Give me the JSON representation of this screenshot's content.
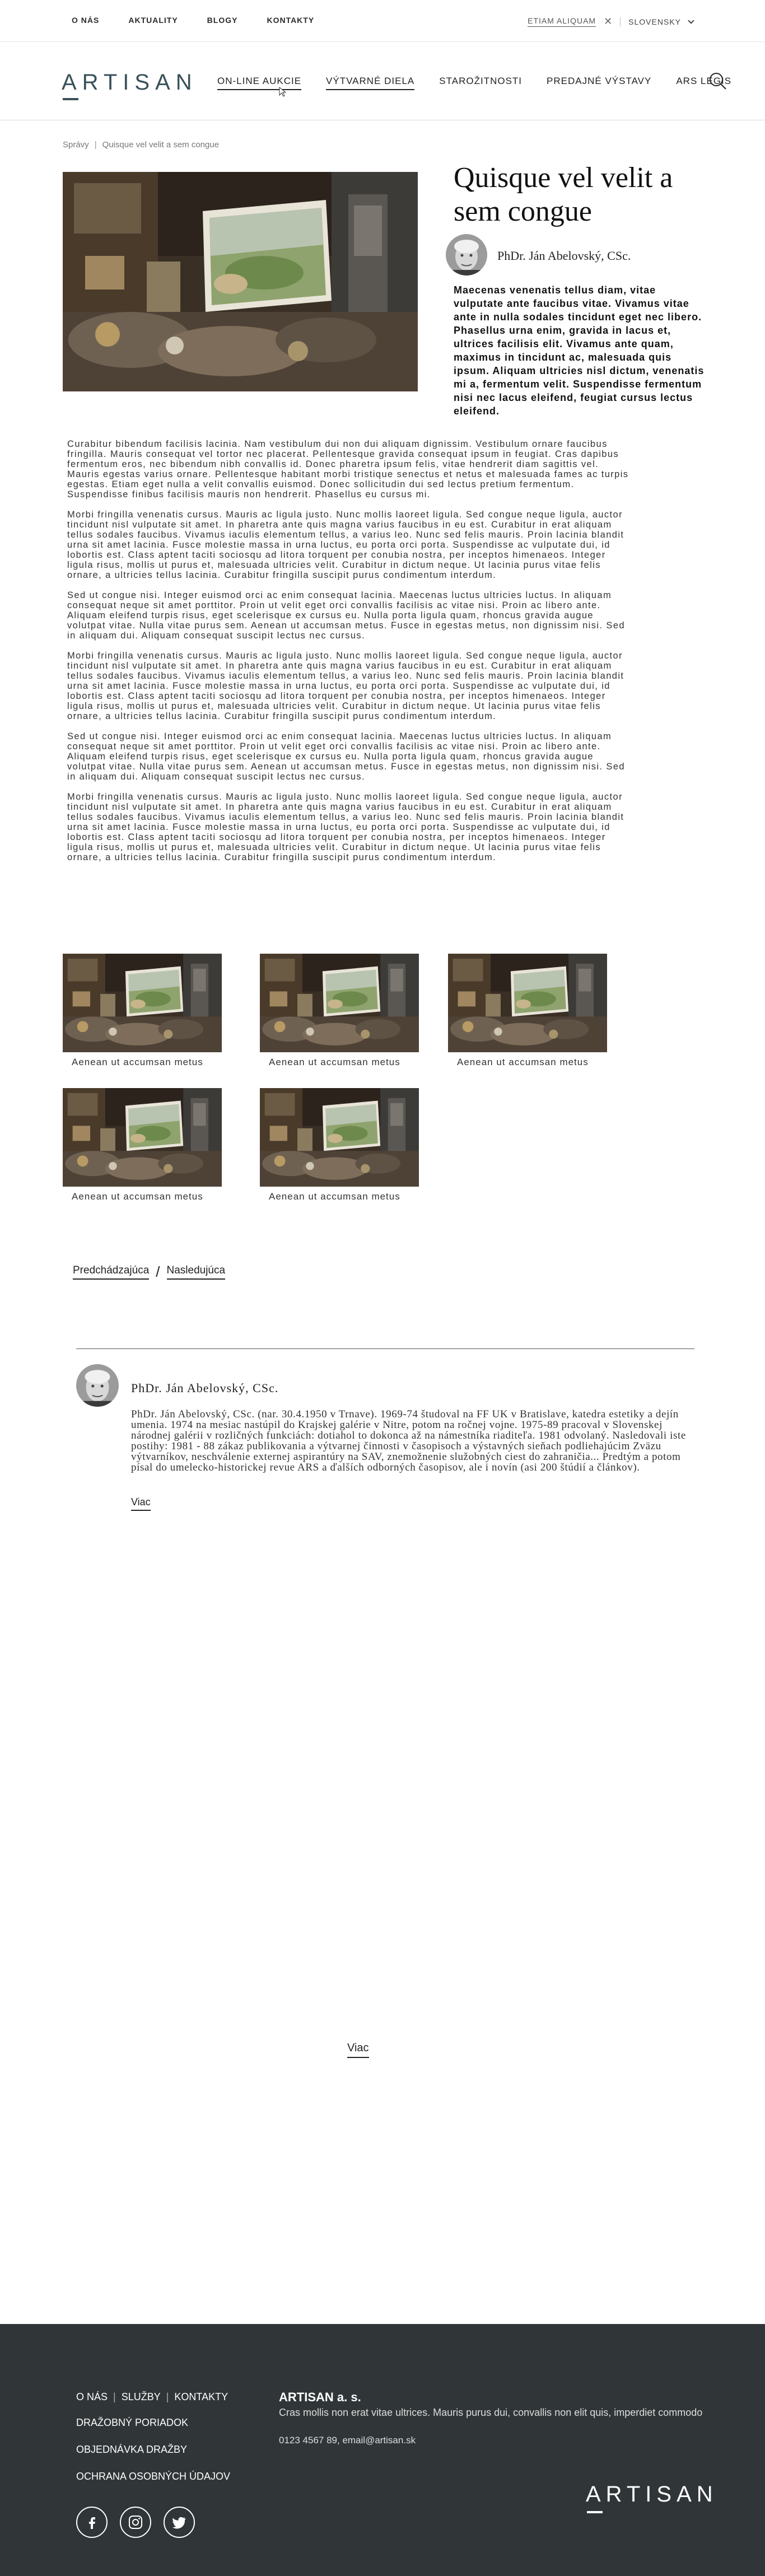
{
  "topbar": {
    "links": [
      "O NÁS",
      "AKTUALITY",
      "BLOGY",
      "KONTAKTY"
    ],
    "search_tag": "ETIAM ALIQUAM",
    "language": "SLOVENSKY"
  },
  "header": {
    "logo": "ARTISAN",
    "nav": [
      "ON-LINE AUKCIE",
      "VÝTVARNÉ DIELA",
      "STAROŽITNOSTI",
      "PREDAJNÉ VÝSTAVY",
      "ARS LEGIS"
    ]
  },
  "breadcrumb": {
    "root": "Správy",
    "current": "Quisque vel velit a sem congue"
  },
  "article": {
    "title": "Quisque vel velit a sem congue",
    "author": "PhDr. Ján Abelovský, CSc.",
    "lead": "Maecenas venenatis tellus diam, vitae vulputate ante faucibus vitae. Vivamus vitae ante in nulla sodales tincidunt eget nec libero. Phasellus urna enim, gravida in lacus et, ultrices facilisis elit. Vivamus ante quam, maximus in tincidunt ac, malesuada quis ipsum. Aliquam ultricies nisl dictum, venenatis mi a, fermentum velit. Suspendisse fermentum nisi nec lacus eleifend, feugiat cursus lectus eleifend.",
    "paragraphs": [
      "Curabitur bibendum facilisis lacinia. Nam vestibulum dui non dui aliquam dignissim. Vestibulum ornare faucibus fringilla. Mauris consequat vel tortor nec placerat. Pellentesque gravida consequat ipsum in feugiat. Cras dapibus fermentum eros, nec bibendum nibh convallis id. Donec pharetra ipsum felis, vitae hendrerit diam sagittis vel. Mauris egestas varius ornare. Pellentesque habitant morbi tristique senectus et netus et malesuada fames ac turpis egestas. Etiam eget nulla a velit convallis euismod. Donec sollicitudin dui sed lectus pretium fermentum. Suspendisse finibus facilisis mauris non hendrerit. Phasellus eu cursus mi.",
      "Morbi fringilla venenatis cursus. Mauris ac ligula justo. Nunc mollis laoreet ligula. Sed congue neque ligula, auctor tincidunt nisl vulputate sit amet. In pharetra ante quis magna varius faucibus in eu est. Curabitur in erat aliquam tellus sodales faucibus. Vivamus iaculis elementum tellus, a varius leo. Nunc sed felis mauris. Proin lacinia blandit urna sit amet lacinia. Fusce molestie massa in urna luctus, eu porta orci porta. Suspendisse ac vulputate dui, id lobortis est. Class aptent taciti sociosqu ad litora torquent per conubia nostra, per inceptos himenaeos. Integer ligula risus, mollis ut purus et, malesuada ultricies velit. Curabitur in dictum neque. Ut lacinia purus vitae felis ornare, a ultricies tellus lacinia. Curabitur fringilla suscipit purus condimentum interdum.",
      "Sed ut congue nisi. Integer euismod orci ac enim consequat lacinia. Maecenas luctus ultricies luctus. In aliquam consequat neque sit amet porttitor. Proin ut velit eget orci convallis facilisis ac vitae nisi. Proin ac libero ante. Aliquam eleifend turpis risus, eget scelerisque ex cursus eu. Nulla porta ligula quam, rhoncus gravida augue volutpat vitae. Nulla vitae purus sem. Aenean ut accumsan metus. Fusce in egestas metus, non dignissim nisi. Sed in aliquam dui. Aliquam consequat suscipit lectus nec cursus.",
      "Morbi fringilla venenatis cursus. Mauris ac ligula justo. Nunc mollis laoreet ligula. Sed congue neque ligula, auctor tincidunt nisl vulputate sit amet. In pharetra ante quis magna varius faucibus in eu est. Curabitur in erat aliquam tellus sodales faucibus. Vivamus iaculis elementum tellus, a varius leo. Nunc sed felis mauris. Proin lacinia blandit urna sit amet lacinia. Fusce molestie massa in urna luctus, eu porta orci porta. Suspendisse ac vulputate dui, id lobortis est. Class aptent taciti sociosqu ad litora torquent per conubia nostra, per inceptos himenaeos. Integer ligula risus, mollis ut purus et, malesuada ultricies velit. Curabitur in dictum neque. Ut lacinia purus vitae felis ornare, a ultricies tellus lacinia. Curabitur fringilla suscipit purus condimentum interdum.",
      "Sed ut congue nisi. Integer euismod orci ac enim consequat lacinia. Maecenas luctus ultricies luctus. In aliquam consequat neque sit amet porttitor. Proin ut velit eget orci convallis facilisis ac vitae nisi. Proin ac libero ante. Aliquam eleifend turpis risus, eget scelerisque ex cursus eu. Nulla porta ligula quam, rhoncus gravida augue volutpat vitae. Nulla vitae purus sem. Aenean ut accumsan metus. Fusce in egestas metus, non dignissim nisi. Sed in aliquam dui. Aliquam consequat suscipit lectus nec cursus.",
      "Morbi fringilla venenatis cursus. Mauris ac ligula justo. Nunc mollis laoreet ligula. Sed congue neque ligula, auctor tincidunt nisl vulputate sit amet. In pharetra ante quis magna varius faucibus in eu est. Curabitur in erat aliquam tellus sodales faucibus. Vivamus iaculis elementum tellus, a varius leo. Nunc sed felis mauris. Proin lacinia blandit urna sit amet lacinia. Fusce molestie massa in urna luctus, eu porta orci porta. Suspendisse ac vulputate dui, id lobortis est. Class aptent taciti sociosqu ad litora torquent per conubia nostra, per inceptos himenaeos. Integer ligula risus, mollis ut purus et, malesuada ultricies velit. Curabitur in dictum neque. Ut lacinia purus vitae felis ornare, a ultricies tellus lacinia. Curabitur fringilla suscipit purus condimentum interdum."
    ]
  },
  "gallery": {
    "captions": [
      "Aenean ut accumsan metus",
      "Aenean ut accumsan metus",
      "Aenean ut accumsan metus",
      "Aenean ut accumsan metus",
      "Aenean ut accumsan metus"
    ]
  },
  "pager": {
    "prev": "Predchádzajúca",
    "next": "Nasledujúca"
  },
  "bio": {
    "name": "PhDr. Ján Abelovský, CSc.",
    "text": "PhDr. Ján Abelovský, CSc. (nar. 30.4.1950 v Trnave). 1969-74 študoval na FF UK v Bratislave, katedra estetiky a dejín umenia. 1974 na mesiac nastúpil do Krajskej galérie v Nitre, potom na ročnej vojne. 1975-89 pracoval v Slovenskej národnej galérii v rozličných funkciách: dotiahol to dokonca až na námestníka riaditeľa. 1981 odvolaný. Nasledovali iste postihy: 1981 - 88 zákaz publikovania a výtvarnej činnosti v časopisoch a výstavných sieňach podliehajúcim Zväzu výtvarníkov, neschválenie externej aspirantúry na SAV, znemožnenie služobných ciest do zahraničia... Predtým a potom písal do umelecko-historickej revue ARS a ďalších odborných časopisov, ale i novín (asi 200 štúdií a článkov).",
    "more": "Viac"
  },
  "more_button": "Viac",
  "footer": {
    "row1": [
      "O NÁS",
      "SLUŽBY",
      "KONTAKTY"
    ],
    "links": [
      "DRAŽOBNÝ PORIADOK",
      "OBJEDNÁVKA DRAŽBY",
      "OCHRANA OSOBNÝCH ÚDAJOV"
    ],
    "company": "ARTISAN a. s.",
    "company_desc": "Cras mollis non erat vitae ultrices. Mauris purus dui, convallis non elit quis, imperdiet commodo",
    "contact": "0123 4567 89, email@artisan.sk",
    "logo": "ARTISAN",
    "social": [
      "facebook-icon",
      "instagram-icon",
      "twitter-icon"
    ]
  },
  "colors": {
    "brand": "#39515a",
    "footer_bg": "#303638"
  }
}
